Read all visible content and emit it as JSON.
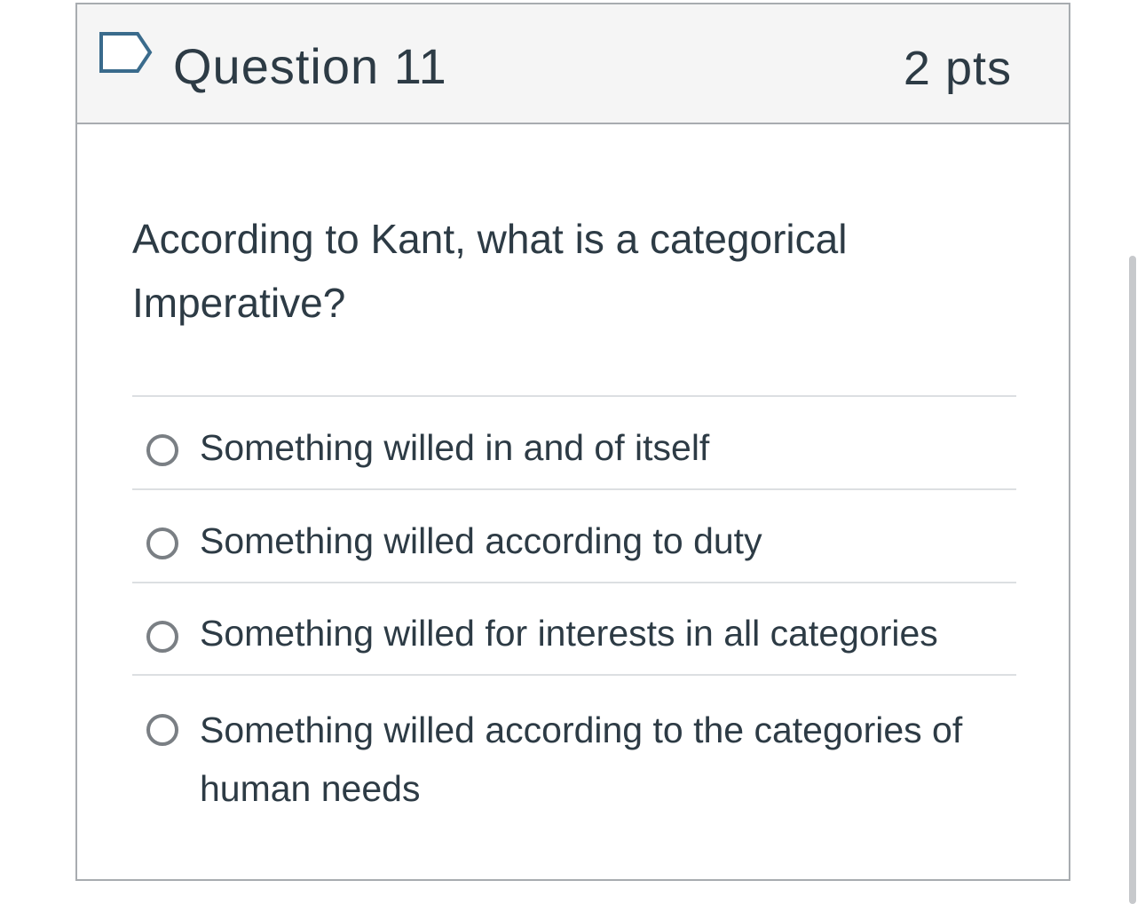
{
  "question": {
    "title": "Question 11",
    "points": "2 pts",
    "flag_icon": "flag-outline-icon",
    "text": "According to Kant, what is a categorical Imperative?"
  },
  "answers": [
    {
      "label": "Something willed in and of itself",
      "selected": false
    },
    {
      "label": "Something willed according to duty",
      "selected": false
    },
    {
      "label": "Something willed for interests in all categories",
      "selected": false
    },
    {
      "label": "Something willed according to the categories of human needs",
      "selected": false
    }
  ],
  "colors": {
    "text": "#2d3b45",
    "header_bg": "#f5f5f5",
    "border": "#a8acb0",
    "divider": "#dcdfe2",
    "flag": "#3a6b8c"
  }
}
